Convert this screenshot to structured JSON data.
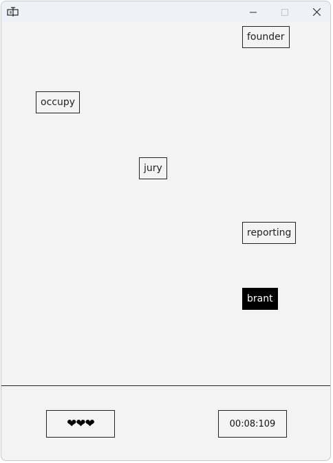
{
  "window": {
    "icon": "game-window-icon",
    "controls": {
      "minimize_icon": "minimize-icon",
      "maximize_icon": "maximize-icon",
      "close_icon": "close-icon"
    }
  },
  "words": [
    {
      "text": "founder",
      "selected": false
    },
    {
      "text": "occupy",
      "selected": false
    },
    {
      "text": "jury",
      "selected": false
    },
    {
      "text": "reporting",
      "selected": false
    },
    {
      "text": "brant",
      "selected": true
    }
  ],
  "status": {
    "lives": "❤❤❤",
    "lives_count": 3,
    "timer": "00:08:109"
  },
  "colors": {
    "selected_bg": "#000000",
    "selected_fg": "#ffffff"
  }
}
